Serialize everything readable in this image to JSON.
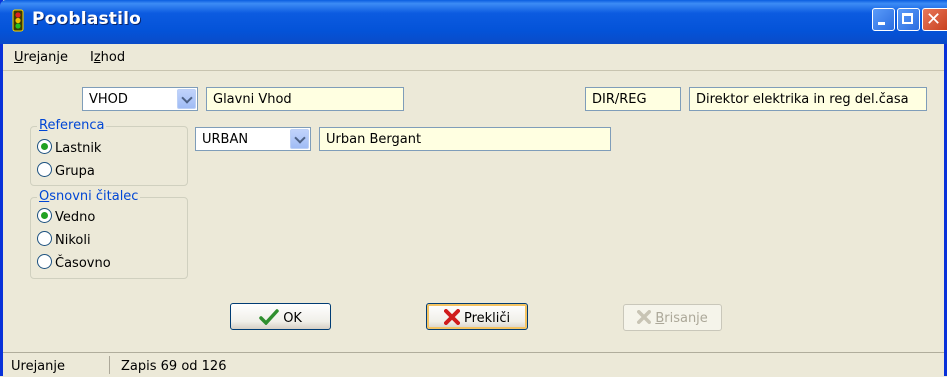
{
  "window": {
    "title": "Pooblastilo"
  },
  "menu": {
    "items": [
      {
        "accel": "U",
        "rest": "rejanje"
      },
      {
        "pre": "I",
        "accel": "z",
        "rest": "hod"
      }
    ]
  },
  "form": {
    "entrance_combo": "VHOD",
    "entrance_name": "Glavni Vhod",
    "code_field": "DIR/REG",
    "code_description": "Direktor elektrika in reg del.časa",
    "person_combo": "URBAN",
    "person_name": "Urban Bergant"
  },
  "groups": {
    "referenca": {
      "title_accel": "R",
      "title_rest": "eferenca",
      "options": [
        "Lastnik",
        "Grupa"
      ],
      "selected": "Lastnik"
    },
    "osnovni": {
      "title_accel": "O",
      "title_rest": "snovni čitalec",
      "options": [
        "Vedno",
        "Nikoli",
        "Časovno"
      ],
      "selected": "Vedno"
    }
  },
  "buttons": {
    "ok": "OK",
    "cancel": "Prekliči",
    "delete_accel": "B",
    "delete_rest": "risanje"
  },
  "status": {
    "mode": "Urejanje",
    "record": "Zapis 69 od 126"
  },
  "colors": {
    "titlebar": "#0453d8",
    "field_bg": "#ffffe1",
    "group_title": "#0046d5"
  }
}
